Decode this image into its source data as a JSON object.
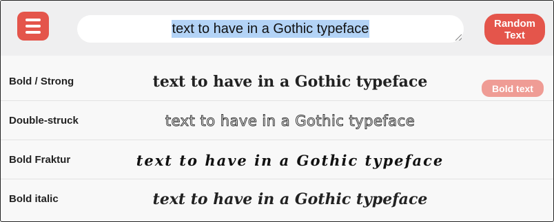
{
  "header": {
    "menu_icon": "hamburger-menu-icon",
    "input_value": "text to have in a Gothic typeface",
    "random_button_label": "Random Text",
    "accent_color": "#e4554b"
  },
  "rows": [
    {
      "label": "Bold / Strong",
      "sample": "text to have in a Gothic typeface"
    },
    {
      "label": "Double-struck",
      "sample": "text to have in a Gothic typeface"
    },
    {
      "label": "Bold Fraktur",
      "sample": "text to have in a Gothic typeface"
    },
    {
      "label": "Bold italic",
      "sample": "text to have in a Gothic typeface"
    }
  ],
  "badge": {
    "label": "Bold text",
    "color": "#ef9c95"
  }
}
